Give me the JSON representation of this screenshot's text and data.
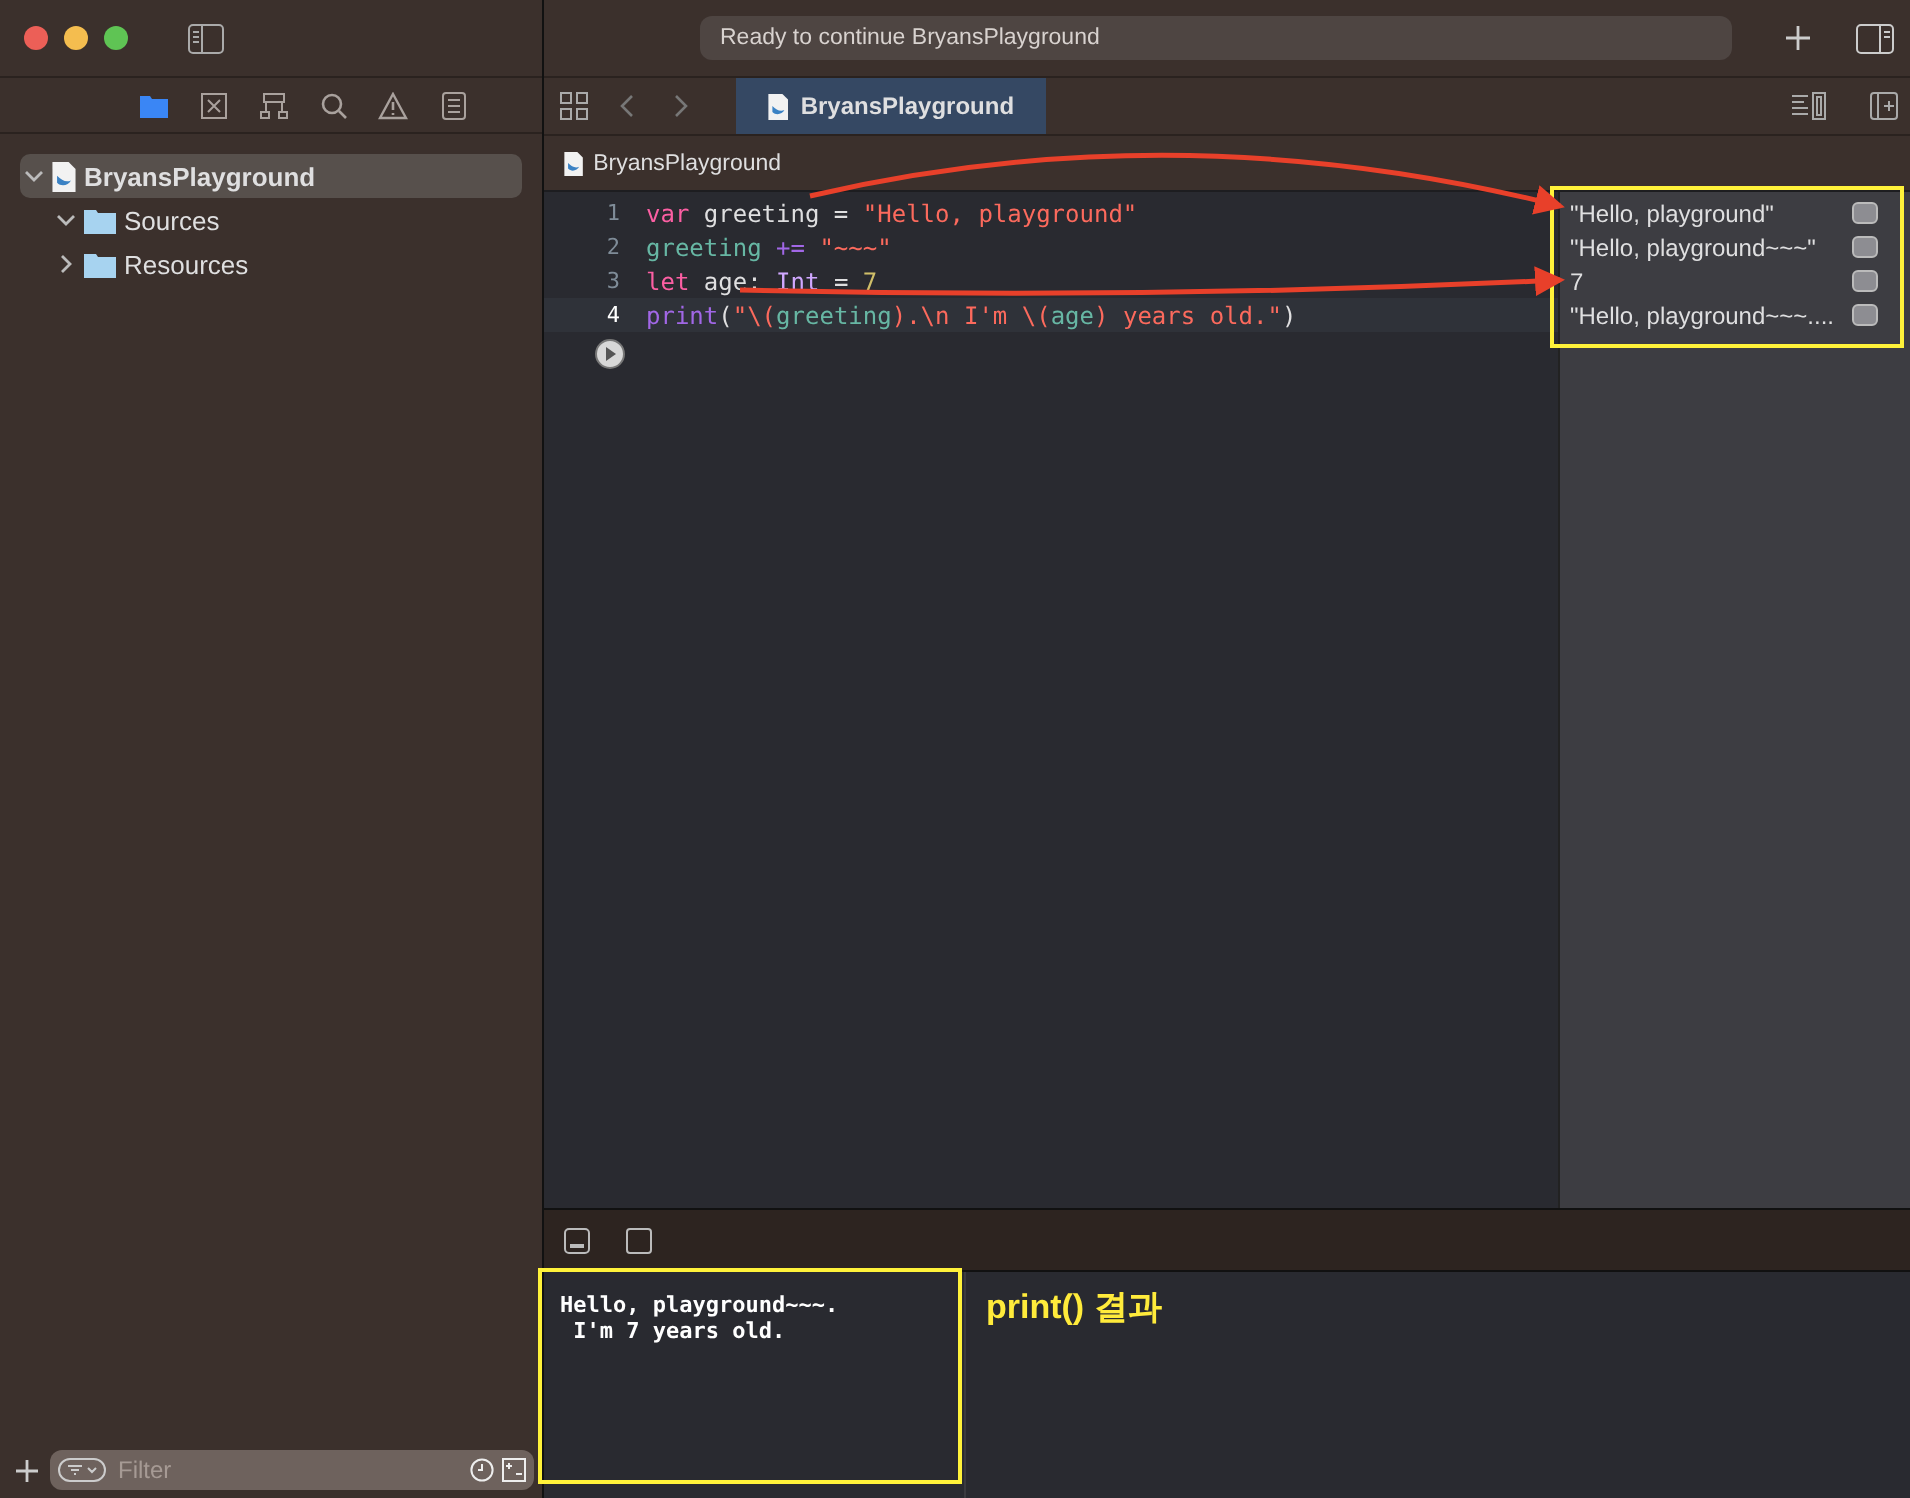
{
  "window": {
    "status": "Ready to continue BryansPlayground"
  },
  "navigator_tabs": [
    {
      "kind": "folder",
      "selected": true
    },
    {
      "kind": "xbox",
      "selected": false
    },
    {
      "kind": "hierarchy",
      "selected": false
    },
    {
      "kind": "search",
      "selected": false
    },
    {
      "kind": "warning",
      "selected": false
    },
    {
      "kind": "list",
      "selected": false
    }
  ],
  "sidebar": {
    "items": [
      {
        "label": "BryansPlayground",
        "kind": "playground",
        "expanded": true,
        "selected": true,
        "children": [
          {
            "label": "Sources",
            "kind": "folder",
            "expanded": true,
            "selected": false
          },
          {
            "label": "Resources",
            "kind": "folder",
            "expanded": false,
            "selected": false
          }
        ]
      }
    ]
  },
  "filter": {
    "placeholder": "Filter"
  },
  "tabs": [
    {
      "label": "BryansPlayground",
      "selected": true
    }
  ],
  "jump_bar": {
    "label": "BryansPlayground"
  },
  "code": {
    "lines": [
      {
        "number": "1",
        "current": false,
        "tokens": [
          {
            "text": "var",
            "kind": "keyword"
          },
          {
            "text": " greeting = ",
            "kind": "plain"
          },
          {
            "text": "\"Hello, playground\"",
            "kind": "string"
          }
        ]
      },
      {
        "number": "2",
        "current": false,
        "tokens": [
          {
            "text": "greeting",
            "kind": "ref"
          },
          {
            "text": " += ",
            "kind": "func"
          },
          {
            "text": "\"~~~\"",
            "kind": "string"
          }
        ]
      },
      {
        "number": "3",
        "current": false,
        "tokens": [
          {
            "text": "let",
            "kind": "keyword"
          },
          {
            "text": " age: ",
            "kind": "plain"
          },
          {
            "text": "Int",
            "kind": "type"
          },
          {
            "text": " = ",
            "kind": "plain"
          },
          {
            "text": "7",
            "kind": "number"
          }
        ]
      },
      {
        "number": "4",
        "current": true,
        "tokens": [
          {
            "text": "print",
            "kind": "func"
          },
          {
            "text": "(",
            "kind": "plain"
          },
          {
            "text": "\"\\(",
            "kind": "string"
          },
          {
            "text": "greeting",
            "kind": "ref"
          },
          {
            "text": ").\\n I'm \\(",
            "kind": "string"
          },
          {
            "text": "age",
            "kind": "ref"
          },
          {
            "text": ") years old.\"",
            "kind": "string"
          },
          {
            "text": ")",
            "kind": "plain"
          }
        ]
      }
    ]
  },
  "results": [
    {
      "text": "\"Hello, playground\""
    },
    {
      "text": "\"Hello, playground~~~\""
    },
    {
      "text": "7"
    },
    {
      "text": "\"Hello, playground~~~...."
    }
  ],
  "console": {
    "lines": [
      "Hello, playground~~~.",
      " I'm 7 years old."
    ]
  },
  "annotation": {
    "label": "print() 결과"
  }
}
